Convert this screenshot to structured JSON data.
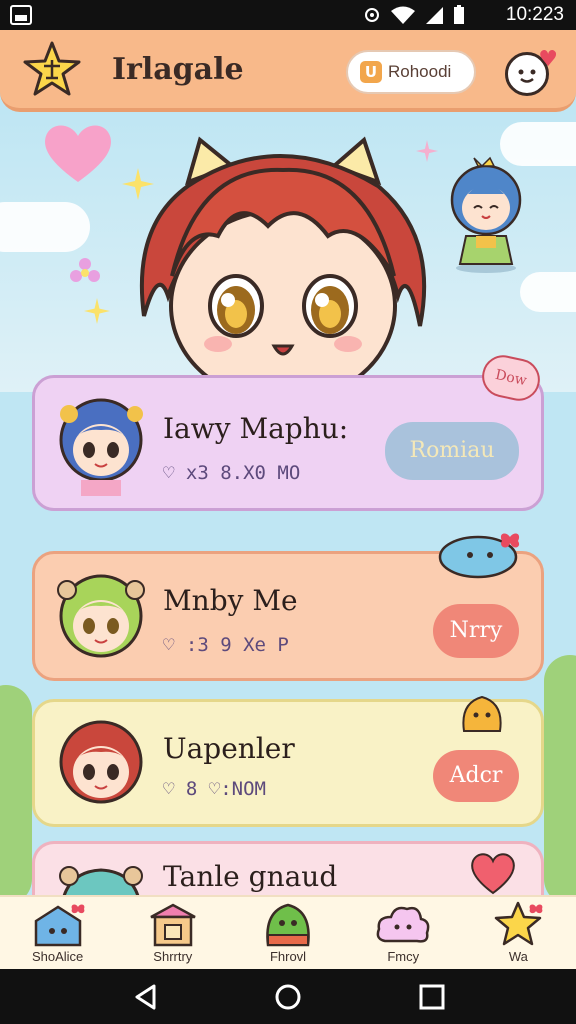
{
  "status_bar": {
    "time": "10:223"
  },
  "app_bar": {
    "title": "Irlagale",
    "pill_button": "Rohoodi",
    "pill_icon": "U"
  },
  "colors": {
    "app_bar": "#f8b98a",
    "card1": "#efd2f3",
    "card2": "#fbcdb0",
    "card3": "#f9f2c6",
    "card4": "#fbe0e6",
    "accent": "#f08778"
  },
  "list": {
    "items": [
      {
        "title": "Iawy Maphu:",
        "tags": "♡ x3 8.X0 MO",
        "button": "Romiau",
        "sticker": "Dow"
      },
      {
        "title": "Mnby Me",
        "tags": "♡ :3 9 Xe P",
        "button": "Nrry"
      },
      {
        "title": "Uapenler",
        "tags": "♡ 8 ♡:NOM",
        "button": "Adcr"
      },
      {
        "title": "Tanle gnaud"
      }
    ]
  },
  "bottom_nav": {
    "items": [
      {
        "label": "ShoAlice",
        "icon": "house-icon"
      },
      {
        "label": "Shrrtry",
        "icon": "shop-icon"
      },
      {
        "label": "Fhrovl",
        "icon": "slime-icon"
      },
      {
        "label": "Fmcy",
        "icon": "cloud-icon"
      },
      {
        "label": "Wa",
        "icon": "star-icon"
      }
    ]
  }
}
